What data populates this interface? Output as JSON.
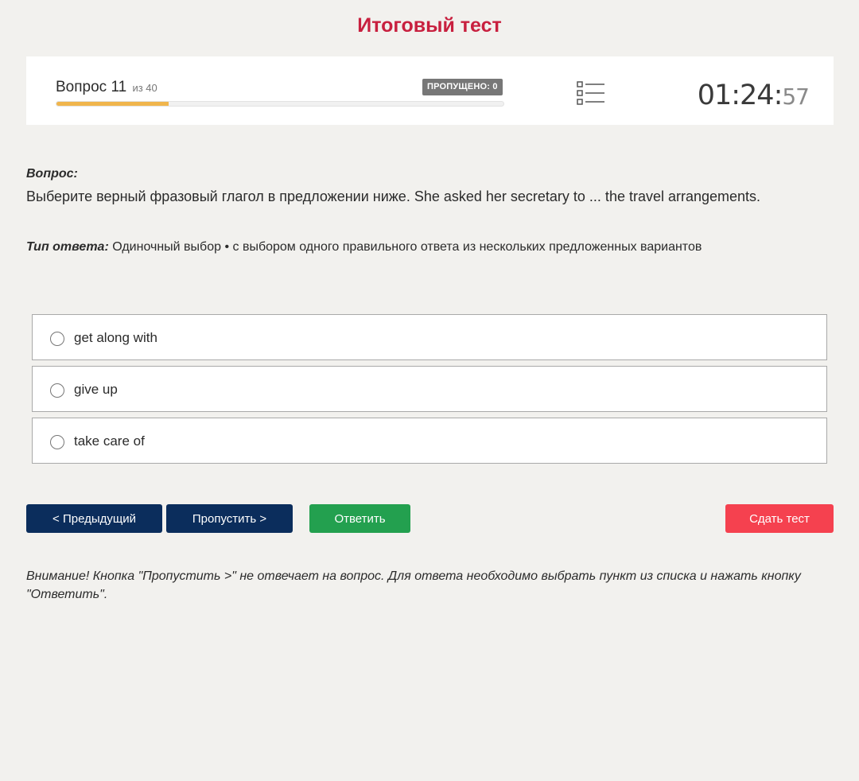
{
  "header": {
    "title": "Итоговый тест"
  },
  "status": {
    "question_label": "Вопрос 11",
    "question_total": "из 40",
    "skipped_badge": "ПРОПУЩЕНО: 0",
    "progress_fraction": 0.25,
    "timer_main": "01:24:",
    "timer_seconds": "57",
    "list_icon": "list-icon"
  },
  "question": {
    "label": "Вопрос:",
    "text": "Выберите верный фразовый глагол в предложении ниже. She asked her secretary to ... the travel arrangements.",
    "answer_type_label": "Тип ответа:",
    "answer_type_value": "Одиночный выбор • с выбором одного правильного ответа из нескольких предложенных вариантов"
  },
  "options": [
    {
      "text": "get along with"
    },
    {
      "text": "give up"
    },
    {
      "text": "take care of"
    }
  ],
  "buttons": {
    "prev": "< Предыдущий",
    "skip": "Пропустить >",
    "answer": "Ответить",
    "submit": "Сдать тест"
  },
  "notice": "Внимание! Кнопка \"Пропустить >\" не отвечает на вопрос. Для ответа необходимо выбрать пункт из списка и нажать кнопку \"Ответить\".",
  "colors": {
    "title": "#c8203f",
    "progress": "#f0b54c",
    "primary": "#0b2d5c",
    "answer": "#23a04f",
    "submit": "#f5414f"
  }
}
